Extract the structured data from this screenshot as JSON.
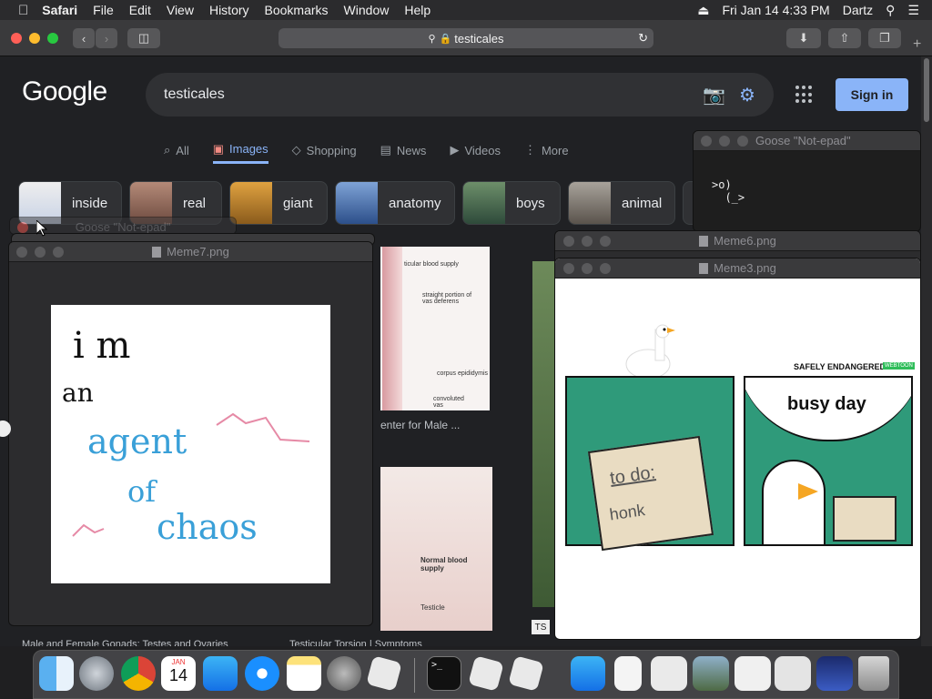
{
  "menubar": {
    "app": "Safari",
    "items": [
      "File",
      "Edit",
      "View",
      "History",
      "Bookmarks",
      "Window",
      "Help"
    ],
    "datetime": "Fri Jan 14  4:33 PM",
    "user": "Dartz"
  },
  "browser": {
    "url": "testicales"
  },
  "google": {
    "logo": "Google",
    "query": "testicales",
    "sign_in": "Sign in",
    "tabs": [
      {
        "label": "All",
        "icon": "⌕"
      },
      {
        "label": "Images",
        "icon": "▣"
      },
      {
        "label": "Shopping",
        "icon": "◇"
      },
      {
        "label": "News",
        "icon": "▤"
      },
      {
        "label": "Videos",
        "icon": "▶"
      },
      {
        "label": "More",
        "icon": "⋮"
      }
    ],
    "chips": [
      "inside",
      "real",
      "giant",
      "anatomy",
      "boys",
      "animal"
    ],
    "results": {
      "caption1": "enter for Male ...",
      "badge": "TS",
      "diagram1": [
        "ticular blood supply",
        "straight portion of vas deferens",
        "corpus epididymis",
        "convoluted vas"
      ],
      "diagram2": [
        "Normal blood supply",
        "Testicle"
      ]
    },
    "bottom_text": [
      "Male and Female Gonads: Testes and Ovaries",
      "Testicular Torsion | Symptoms"
    ]
  },
  "colors": {
    "google_blue": "#8ab4f8",
    "goose_green": "#2f9a7a"
  },
  "goose_terminal": {
    "title": "Goose \"Not-epad\"",
    "lines": [
      ">o)",
      "  (_>"
    ]
  },
  "meme7": {
    "title": "Meme7.png",
    "ghost_title": "Goose \"Not-epad\"",
    "words": [
      "i m",
      "an",
      "agent",
      "of",
      "chaos"
    ]
  },
  "meme6": {
    "title": "Meme6.png"
  },
  "meme3": {
    "title": "Meme3.png",
    "brand": "SAFELY ENDANGERED",
    "brand_tag": "WEBTOON",
    "panel2_text": "busy day",
    "note_line1": "to do:",
    "note_line2": "honk"
  },
  "dock": {
    "items": [
      "finder-icon",
      "launchpad-icon",
      "chrome-icon",
      "calendar-icon",
      "app-store-icon",
      "safari-icon",
      "notes-icon",
      "system-preferences-icon",
      "roblox-icon",
      "terminal-icon",
      "roblox-icon",
      "roblox-icon",
      "app-store-icon",
      "file-icon",
      "window-thumb",
      "window-thumb",
      "window-thumb",
      "window-thumb",
      "window-thumb",
      "trash-icon"
    ],
    "calendar_month": "JAN",
    "calendar_day": "14"
  }
}
